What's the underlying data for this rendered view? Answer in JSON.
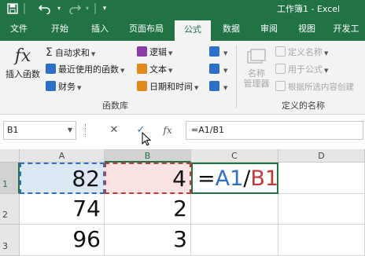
{
  "titlebar": {
    "save_icon": "save-icon",
    "undo_icon": "undo-icon",
    "redo_icon": "redo-icon",
    "customize_icon": "customize-qat-icon",
    "title": "工作簿1 - Excel"
  },
  "tabs": [
    {
      "label": "文件"
    },
    {
      "label": "开始"
    },
    {
      "label": "插入"
    },
    {
      "label": "页面布局"
    },
    {
      "label": "公式",
      "active": true
    },
    {
      "label": "数据"
    },
    {
      "label": "审阅"
    },
    {
      "label": "视图"
    },
    {
      "label": "开发工"
    }
  ],
  "ribbon": {
    "insert_function": {
      "icon": "fx",
      "label": "插入函数"
    },
    "library": {
      "autosum": "自动求和",
      "recent": "最近使用的函数",
      "financial": "财务",
      "logical": "逻辑",
      "text": "文本",
      "datetime": "日期和时间",
      "group_label": "函数库"
    },
    "defined_names": {
      "name_manager_line1": "名称",
      "name_manager_line2": "管理器",
      "define_name": "定义名称",
      "use_in_formula": "用于公式",
      "create_from_selection": "根据所选内容创建",
      "group_label": "定义的名称"
    }
  },
  "formula_bar": {
    "name_box": "B1",
    "cancel": "✕",
    "enter": "✓",
    "fx": "fx",
    "formula": "=A1/B1"
  },
  "grid": {
    "columns": [
      "A",
      "B",
      "C",
      "D"
    ],
    "rows": [
      "1",
      "2",
      "3"
    ],
    "cells": {
      "A1": "82",
      "B1": "4",
      "A2": "74",
      "B2": "2",
      "A3": "96",
      "B3": "3"
    },
    "c1_formula": {
      "eq": "=",
      "ref_a": "A1",
      "slash": "/",
      "ref_b": "B1"
    }
  },
  "colors": {
    "accent": "#217346",
    "ref_a": "#2e6fc7",
    "ref_b": "#c23a3a"
  }
}
